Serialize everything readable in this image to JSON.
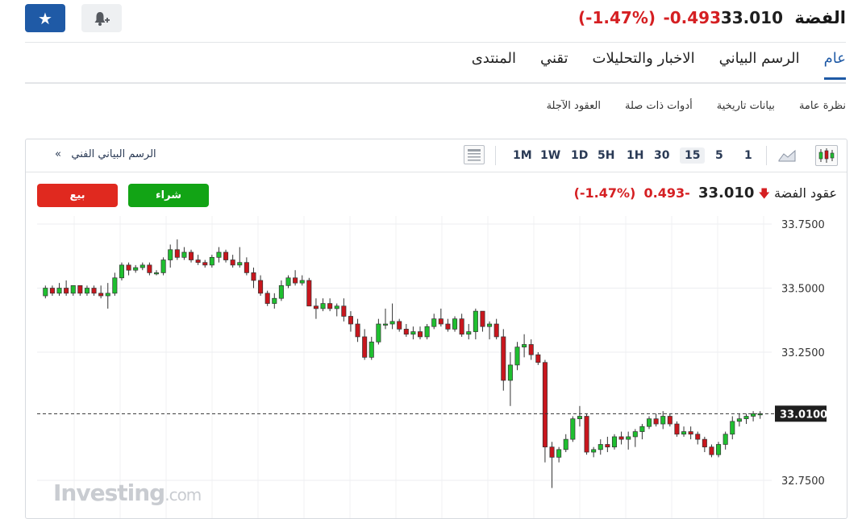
{
  "header": {
    "title": "الفضة",
    "price": "33.010",
    "change": "-0.493",
    "change_pct": "(-1.47%)"
  },
  "tabs": [
    {
      "label": "عام",
      "active": true
    },
    {
      "label": "الرسم البياني",
      "active": false
    },
    {
      "label": "الاخبار والتحليلات",
      "active": false
    },
    {
      "label": "تقني",
      "active": false
    },
    {
      "label": "المنتدى",
      "active": false
    }
  ],
  "subtabs": [
    "نظرة عامة",
    "بيانات تاريخية",
    "أدوات ذات صلة",
    "العقود الآجلة"
  ],
  "toolbar": {
    "timeframes": [
      "1",
      "5",
      "15",
      "30",
      "1H",
      "5H",
      "1D",
      "1W",
      "1M"
    ],
    "active_timeframe": "15",
    "tech_chart_link": "الرسم البياني الفني"
  },
  "chart_header": {
    "name": "عقود الفضة",
    "price": "33.010",
    "change": "-0.493",
    "change_pct": "(-1.47%)",
    "buy_label": "شراء",
    "sell_label": "بيع"
  },
  "watermark": {
    "brand": "Investing",
    "suffix": ".com"
  },
  "colors": {
    "up": "#1fbf30",
    "down": "#c8161d",
    "accent": "#1f5aa6"
  },
  "chart_data": {
    "type": "candlestick",
    "ylim": [
      32.7,
      33.8
    ],
    "yticks": [
      "33.7500",
      "33.5000",
      "33.2500",
      "32.7500"
    ],
    "last_price": "33.0100",
    "last_price_value": 33.01,
    "candles": [
      [
        33.47,
        33.51,
        33.46,
        33.5
      ],
      [
        33.5,
        33.51,
        33.47,
        33.48
      ],
      [
        33.48,
        33.52,
        33.47,
        33.5
      ],
      [
        33.5,
        33.53,
        33.47,
        33.48
      ],
      [
        33.48,
        33.51,
        33.47,
        33.51
      ],
      [
        33.51,
        33.51,
        33.47,
        33.48
      ],
      [
        33.48,
        33.51,
        33.47,
        33.5
      ],
      [
        33.5,
        33.51,
        33.47,
        33.48
      ],
      [
        33.48,
        33.51,
        33.46,
        33.47
      ],
      [
        33.47,
        33.52,
        33.42,
        33.48
      ],
      [
        33.48,
        33.56,
        33.47,
        33.54
      ],
      [
        33.54,
        33.6,
        33.53,
        33.59
      ],
      [
        33.59,
        33.6,
        33.55,
        33.57
      ],
      [
        33.57,
        33.59,
        33.56,
        33.58
      ],
      [
        33.58,
        33.6,
        33.57,
        33.59
      ],
      [
        33.59,
        33.6,
        33.55,
        33.56
      ],
      [
        33.56,
        33.57,
        33.55,
        33.56
      ],
      [
        33.56,
        33.62,
        33.55,
        33.61
      ],
      [
        33.61,
        33.67,
        33.58,
        33.65
      ],
      [
        33.65,
        33.69,
        33.61,
        33.62
      ],
      [
        33.62,
        33.66,
        33.61,
        33.64
      ],
      [
        33.64,
        33.65,
        33.6,
        33.61
      ],
      [
        33.61,
        33.63,
        33.59,
        33.6
      ],
      [
        33.6,
        33.61,
        33.58,
        33.59
      ],
      [
        33.59,
        33.63,
        33.58,
        33.62
      ],
      [
        33.62,
        33.66,
        33.6,
        33.64
      ],
      [
        33.64,
        33.65,
        33.6,
        33.61
      ],
      [
        33.61,
        33.63,
        33.58,
        33.59
      ],
      [
        33.59,
        33.66,
        33.58,
        33.6
      ],
      [
        33.6,
        33.62,
        33.55,
        33.56
      ],
      [
        33.56,
        33.58,
        33.5,
        33.53
      ],
      [
        33.53,
        33.55,
        33.47,
        33.48
      ],
      [
        33.48,
        33.49,
        33.43,
        33.44
      ],
      [
        33.44,
        33.48,
        33.42,
        33.46
      ],
      [
        33.46,
        33.53,
        33.45,
        33.51
      ],
      [
        33.51,
        33.55,
        33.5,
        33.54
      ],
      [
        33.54,
        33.57,
        33.51,
        33.52
      ],
      [
        33.52,
        33.55,
        33.51,
        33.53
      ],
      [
        33.53,
        33.54,
        33.47,
        33.43
      ],
      [
        33.43,
        33.46,
        33.38,
        33.42
      ],
      [
        33.42,
        33.46,
        33.41,
        33.44
      ],
      [
        33.44,
        33.46,
        33.41,
        33.42
      ],
      [
        33.42,
        33.44,
        33.39,
        33.43
      ],
      [
        33.43,
        33.46,
        33.37,
        33.39
      ],
      [
        33.39,
        33.41,
        33.33,
        33.36
      ],
      [
        33.36,
        33.38,
        33.29,
        33.31
      ],
      [
        33.31,
        33.34,
        33.22,
        33.23
      ],
      [
        33.23,
        33.31,
        33.22,
        33.29
      ],
      [
        33.29,
        33.38,
        33.28,
        33.36
      ],
      [
        33.36,
        33.42,
        33.34,
        33.36
      ],
      [
        33.36,
        33.44,
        33.34,
        33.37
      ],
      [
        33.37,
        33.38,
        33.33,
        33.34
      ],
      [
        33.34,
        33.36,
        33.31,
        33.32
      ],
      [
        33.32,
        33.35,
        33.3,
        33.33
      ],
      [
        33.33,
        33.35,
        33.3,
        33.31
      ],
      [
        33.31,
        33.36,
        33.3,
        33.35
      ],
      [
        33.35,
        33.4,
        33.34,
        33.38
      ],
      [
        33.38,
        33.42,
        33.35,
        33.36
      ],
      [
        33.36,
        33.38,
        33.33,
        33.34
      ],
      [
        33.34,
        33.39,
        33.33,
        33.38
      ],
      [
        33.38,
        33.4,
        33.31,
        33.32
      ],
      [
        33.32,
        33.36,
        33.3,
        33.33
      ],
      [
        33.33,
        33.42,
        33.3,
        33.41
      ],
      [
        33.41,
        33.41,
        33.33,
        33.35
      ],
      [
        33.35,
        33.37,
        33.3,
        33.36
      ],
      [
        33.36,
        33.38,
        33.3,
        33.31
      ],
      [
        33.31,
        33.34,
        33.1,
        33.14
      ],
      [
        33.14,
        33.25,
        33.04,
        33.2
      ],
      [
        33.2,
        33.29,
        33.18,
        33.27
      ],
      [
        33.27,
        33.32,
        33.23,
        33.28
      ],
      [
        33.28,
        33.3,
        33.22,
        33.24
      ],
      [
        33.24,
        33.25,
        33.2,
        33.21
      ],
      [
        33.21,
        33.22,
        32.82,
        32.88
      ],
      [
        32.88,
        32.9,
        32.72,
        32.84
      ],
      [
        32.84,
        32.88,
        32.82,
        32.87
      ],
      [
        32.87,
        32.93,
        32.86,
        32.91
      ],
      [
        32.91,
        33.0,
        32.9,
        32.99
      ],
      [
        32.99,
        33.04,
        32.96,
        33.0
      ],
      [
        33.0,
        33.01,
        32.85,
        32.86
      ],
      [
        32.86,
        32.88,
        32.84,
        32.87
      ],
      [
        32.87,
        32.91,
        32.85,
        32.89
      ],
      [
        32.89,
        32.92,
        32.86,
        32.88
      ],
      [
        32.88,
        32.93,
        32.87,
        32.92
      ],
      [
        32.92,
        32.94,
        32.89,
        32.91
      ],
      [
        32.91,
        32.94,
        32.87,
        32.92
      ],
      [
        32.92,
        32.95,
        32.88,
        32.94
      ],
      [
        32.94,
        32.97,
        32.91,
        32.96
      ],
      [
        32.96,
        33.0,
        32.95,
        32.99
      ],
      [
        32.99,
        33.01,
        32.96,
        32.97
      ],
      [
        32.97,
        33.02,
        32.95,
        33.0
      ],
      [
        33.0,
        33.01,
        32.96,
        32.97
      ],
      [
        32.97,
        32.98,
        32.92,
        32.93
      ],
      [
        32.93,
        32.96,
        32.92,
        32.94
      ],
      [
        32.94,
        32.96,
        32.91,
        32.93
      ],
      [
        32.93,
        32.94,
        32.89,
        32.91
      ],
      [
        32.91,
        32.92,
        32.86,
        32.88
      ],
      [
        32.88,
        32.89,
        32.84,
        32.85
      ],
      [
        32.85,
        32.9,
        32.84,
        32.89
      ],
      [
        32.89,
        32.94,
        32.87,
        32.93
      ],
      [
        32.93,
        33.0,
        32.91,
        32.98
      ],
      [
        32.98,
        33.01,
        32.96,
        32.99
      ],
      [
        32.99,
        33.01,
        32.97,
        33.0
      ],
      [
        33.0,
        33.02,
        32.98,
        33.01
      ],
      [
        33.01,
        33.02,
        32.99,
        33.01
      ]
    ]
  }
}
